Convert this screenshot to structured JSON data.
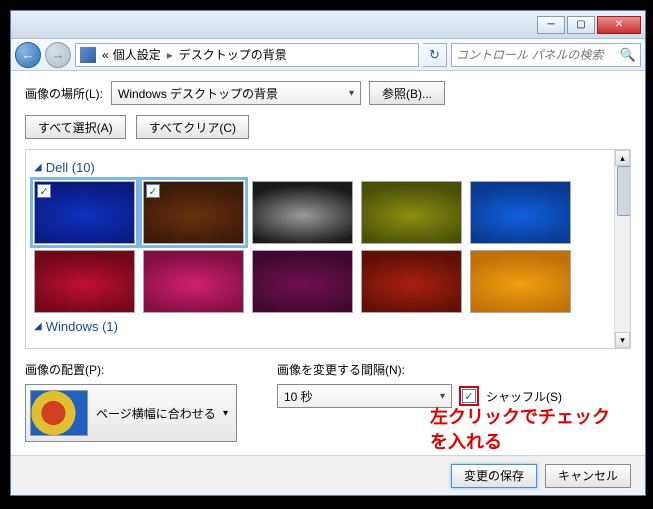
{
  "nav": {
    "breadcrumb_prefix": "«",
    "breadcrumb_1": "個人設定",
    "breadcrumb_2": "デスクトップの背景",
    "search_placeholder": "コントロール パネルの検索"
  },
  "location": {
    "label": "画像の場所(L):",
    "value": "Windows デスクトップの背景",
    "browse": "参照(B)..."
  },
  "buttons": {
    "select_all": "すべて選択(A)",
    "clear_all": "すべてクリア(C)",
    "save": "変更の保存",
    "cancel": "キャンセル"
  },
  "groups": [
    {
      "name": "Dell",
      "count": 10
    },
    {
      "name": "Windows",
      "count": 1
    }
  ],
  "thumbs_row1": [
    {
      "color1": "#0a1a80",
      "color2": "#1030c0",
      "selected": true,
      "checked": true
    },
    {
      "color1": "#3a1a08",
      "color2": "#6a3010",
      "selected": true,
      "checked": true
    },
    {
      "color1": "#1a1a1a",
      "color2": "#9a9a9a",
      "selected": false,
      "checked": false
    },
    {
      "color1": "#4a5008",
      "color2": "#8a9010",
      "selected": false,
      "checked": false
    },
    {
      "color1": "#0a3a90",
      "color2": "#1060e0",
      "selected": false,
      "checked": false
    }
  ],
  "thumbs_row2": [
    {
      "color1": "#700818",
      "color2": "#c01030",
      "selected": false,
      "checked": false
    },
    {
      "color1": "#801040",
      "color2": "#d02070",
      "selected": false,
      "checked": false
    },
    {
      "color1": "#400830",
      "color2": "#701050",
      "selected": false,
      "checked": false
    },
    {
      "color1": "#601008",
      "color2": "#a82010",
      "selected": false,
      "checked": false
    },
    {
      "color1": "#c07008",
      "color2": "#f0a010",
      "selected": false,
      "checked": false
    }
  ],
  "position": {
    "label": "画像の配置(P):",
    "value": "ページ横幅に合わせる"
  },
  "interval": {
    "label": "画像を変更する間隔(N):",
    "value": "10 秒"
  },
  "shuffle": {
    "label": "シャッフル(S)",
    "checked": true
  },
  "annotation": {
    "text1": "左クリックでチェック",
    "text2": "を入れる"
  }
}
